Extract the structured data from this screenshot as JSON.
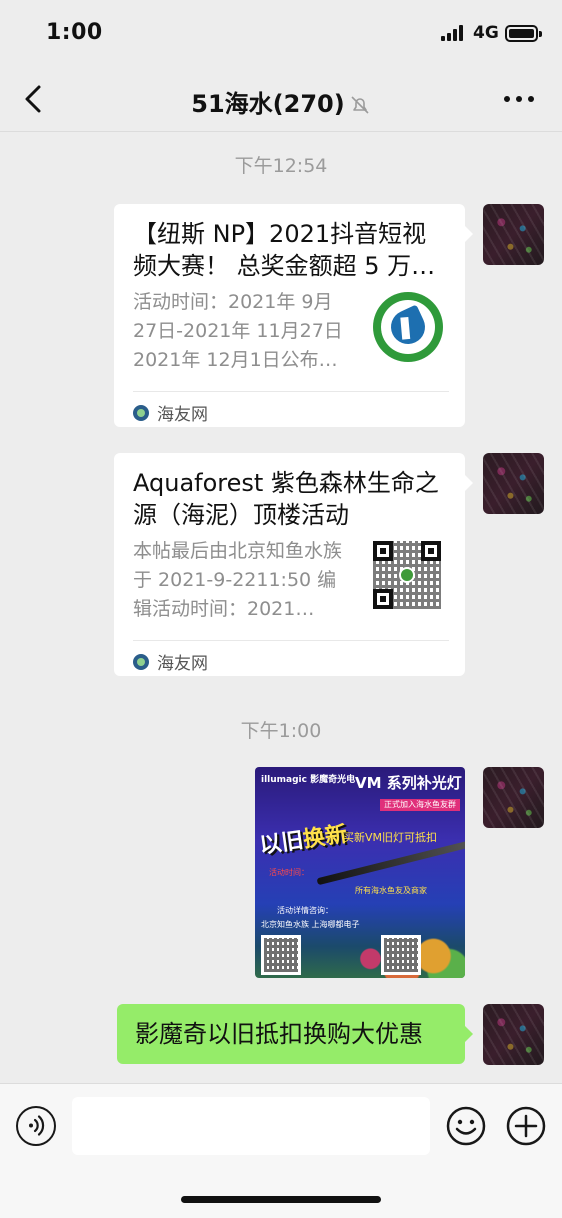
{
  "status_bar": {
    "time": "1:00",
    "network": "4G"
  },
  "nav": {
    "title": "51海水(270)",
    "back_icon": "chevron-left-icon",
    "mute_icon": "bell-off-icon",
    "more_icon": "more-dots-icon"
  },
  "messages": {
    "timestamp_1": "下午12:54",
    "card_1": {
      "title": "【纽斯 NP】2021抖音短视频大赛！ 总奖金额超 5 万…",
      "desc": "活动时间：2021年 9月27日-2021年 11月27日 2021年 12月1日公布…",
      "source": "海友网"
    },
    "card_2": {
      "title": "Aquaforest 紫色森林生命之源（海泥）顶楼活动",
      "desc": "本帖最后由北京知鱼水族于 2021-9-2211:50 编辑活动时间：2021…",
      "source": "海友网"
    },
    "timestamp_2": "下午1:00",
    "poster": {
      "brand": "illumagic 影魔奇光电",
      "headline": "VM 系列补光灯",
      "band": "正式加入海水鱼友群",
      "big_a": "以旧",
      "big_b": "换新",
      "sub": "买新VM旧灯可抵扣",
      "red": "活动时间：",
      "note": "所有海水鱼友及商家",
      "contact": "活动详情咨询：",
      "shops": "北京知鱼水族  上海哪都电子"
    },
    "text_message": "影魔奇以旧抵扣换购大优惠"
  },
  "input_bar": {
    "voice_icon": "voice-icon",
    "emoji_icon": "emoji-icon",
    "plus_icon": "plus-icon",
    "input_value": ""
  }
}
